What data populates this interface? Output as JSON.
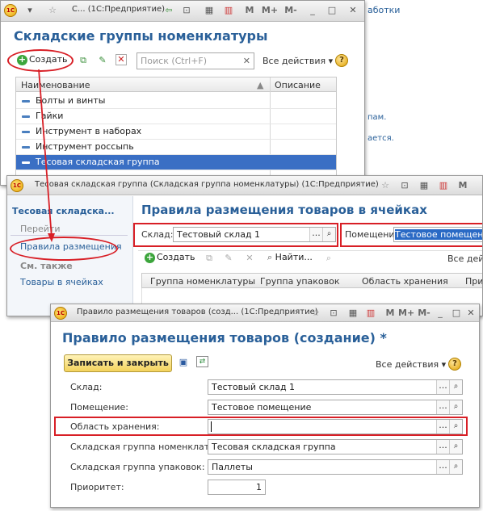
{
  "w1": {
    "title": "С... (1С:Предприятие)",
    "heading": "Складские группы номенклатуры",
    "create_label": "Создать",
    "search_placeholder": "Поиск (Ctrl+F)",
    "all_actions": "Все действия",
    "col_name": "Наименование",
    "col_desc": "Описание",
    "rows": [
      "Болты и винты",
      "Гайки",
      "Инструмент в наборах",
      "Инструмент россыпь",
      "Тесовая складская группа"
    ],
    "tb_m": "M",
    "tb_mplus": "M+",
    "tb_mminus": "M-"
  },
  "bg": {
    "line1": "аботки",
    "line2": "пам.",
    "line3": "ается."
  },
  "w2": {
    "title": "Тесовая складская группа (Складская группа номенклатуры)  (1С:Предприятие)",
    "side_title": "Тесовая складска...",
    "goto": "Перейти",
    "rules_link": "Правила размещения",
    "see_also": "См. также",
    "goods_link": "Товары в ячейках",
    "heading": "Правила размещения товаров в ячейках",
    "sklad_label": "Склад:",
    "sklad_value": "Тестовый склад 1",
    "pom_label": "Помещение:",
    "pom_value": "Тестовое помещение",
    "create_label": "Создать",
    "find_label": "Найти...",
    "all_actions": "Все дейс",
    "cols": [
      "Группа номенклатуры",
      "Группа упаковок",
      "Область хранения",
      "При"
    ]
  },
  "w3": {
    "title": "Правило размещения товаров (созд...  (1С:Предприятие)",
    "heading": "Правило размещения товаров (создание) *",
    "save_close": "Записать и закрыть",
    "all_actions": "Все действия",
    "fields": [
      {
        "label": "Склад:",
        "value": "Тестовый склад 1"
      },
      {
        "label": "Помещение:",
        "value": "Тестовое помещение"
      },
      {
        "label": "Область хранения:",
        "value": ""
      },
      {
        "label": "Складская группа номенклатуры:",
        "value": "Тесовая складская группа"
      },
      {
        "label": "Складская группа упаковок:",
        "value": "Паллеты"
      }
    ],
    "priority_label": "Приоритет:",
    "priority_value": "1",
    "tb_m": "M",
    "tb_mplus": "M+",
    "tb_mminus": "M-"
  }
}
